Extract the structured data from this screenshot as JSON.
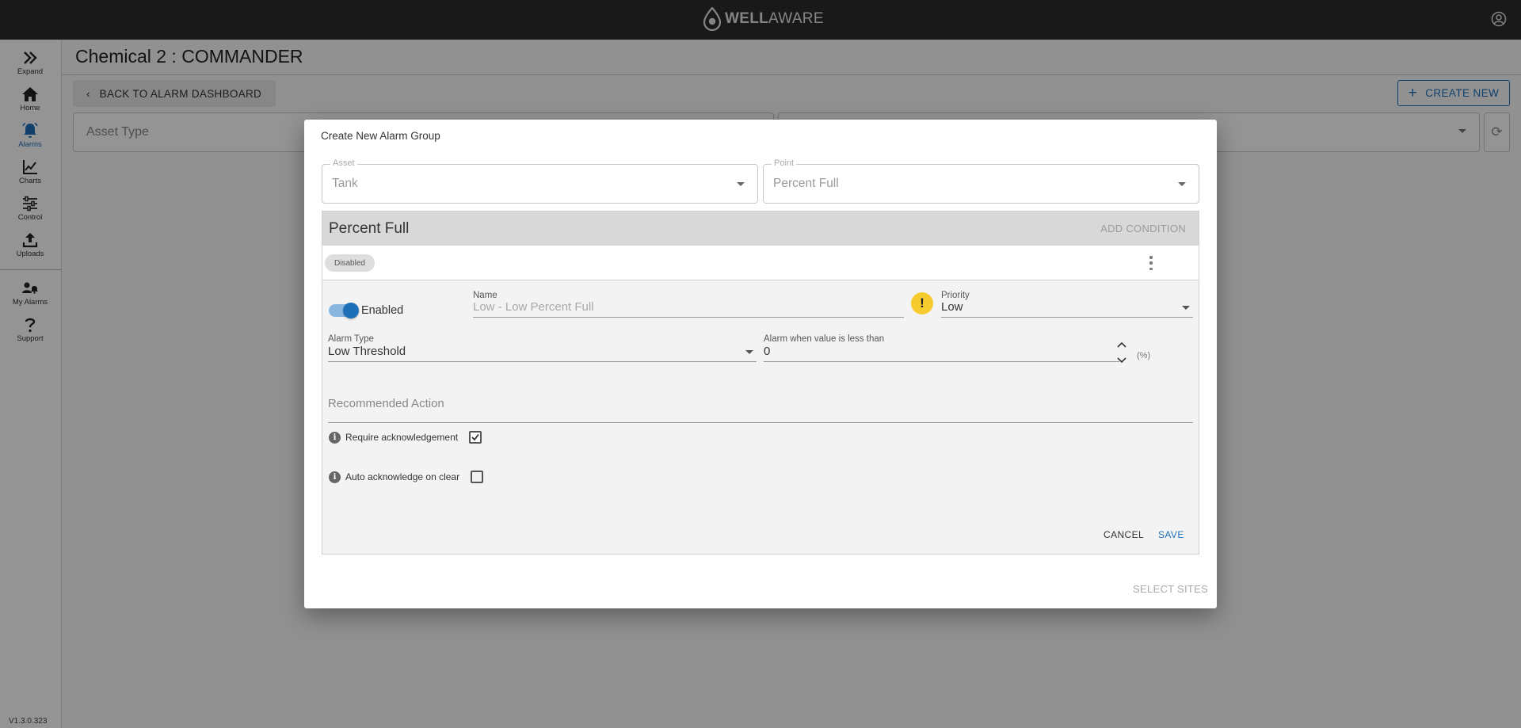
{
  "app": {
    "logo_text_bold": "WELL",
    "logo_text_light": "AWARE"
  },
  "sidebar": {
    "items": [
      {
        "label": "Expand",
        "icon": "double-chevron-right-icon"
      },
      {
        "label": "Home",
        "icon": "home-icon"
      },
      {
        "label": "Alarms",
        "icon": "bell-icon"
      },
      {
        "label": "Charts",
        "icon": "line-chart-icon"
      },
      {
        "label": "Control",
        "icon": "sliders-icon"
      },
      {
        "label": "Uploads",
        "icon": "upload-icon"
      },
      {
        "label": "My Alarms",
        "icon": "people-bell-icon"
      },
      {
        "label": "Support",
        "icon": "question-icon"
      }
    ],
    "version": "V1.3.0.323"
  },
  "page": {
    "title": "Chemical 2 : COMMANDER",
    "back_label": "BACK TO ALARM DASHBOARD",
    "create_label": "CREATE NEW",
    "asset_type_placeholder": "Asset Type"
  },
  "dialog": {
    "title": "Create New Alarm Group",
    "asset": {
      "label": "Asset",
      "value": "Tank"
    },
    "point": {
      "label": "Point",
      "value": "Percent Full"
    },
    "panel": {
      "title": "Percent Full",
      "add_condition": "ADD CONDITION",
      "status_chip": "Disabled",
      "enabled_label": "Enabled",
      "enabled": true,
      "name_label": "Name",
      "name_placeholder": "Low - Low Percent Full",
      "priority_label": "Priority",
      "priority_value": "Low",
      "alarm_type_label": "Alarm Type",
      "alarm_type_value": "Low Threshold",
      "threshold_label": "Alarm when value is less than",
      "threshold_value": "0",
      "unit": "(%)",
      "recommended_placeholder": "Recommended Action",
      "require_ack_label": "Require acknowledgement",
      "require_ack_checked": true,
      "auto_ack_label": "Auto acknowledge on clear",
      "auto_ack_checked": false,
      "cancel_label": "CANCEL",
      "save_label": "SAVE"
    },
    "select_sites_label": "SELECT SITES"
  },
  "colors": {
    "accent": "#1d6fb8",
    "warning": "#f5cb2e",
    "topbar": "#2b2b2b"
  }
}
